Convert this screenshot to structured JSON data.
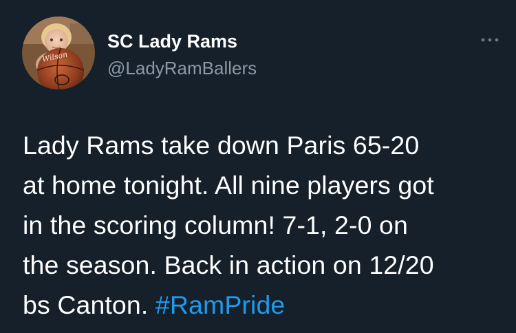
{
  "account": {
    "display_name": "SC Lady Rams",
    "handle": "@LadyRamBallers",
    "avatar_icon": "profile-photo-child-with-basketball"
  },
  "header": {
    "more_icon": "more-horizontal-icon"
  },
  "tweet": {
    "lines": [
      "Lady Rams take down Paris 65-20",
      "at home tonight. All nine players got",
      "in the scoring column! 7-1, 2-0 on",
      "the season. Back in action on 12/20",
      "bs Canton. "
    ],
    "hashtag": "#RamPride"
  },
  "colors": {
    "background": "#15202b",
    "text": "#ffffff",
    "secondary_text": "#8b98a5",
    "accent": "#1d9bf0"
  }
}
